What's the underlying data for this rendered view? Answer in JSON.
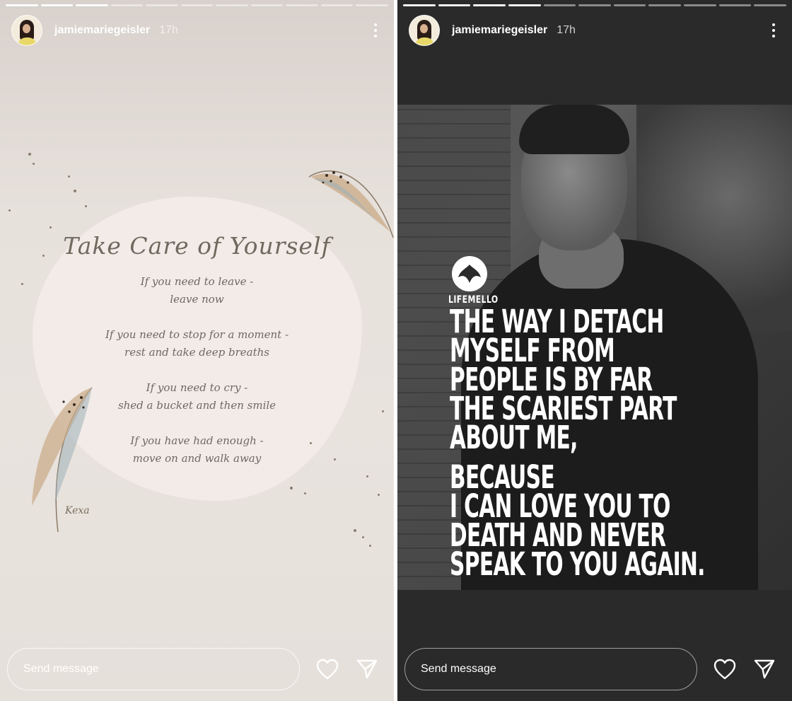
{
  "left_story": {
    "username": "jamiemariegeisler",
    "time": "17h",
    "poem": {
      "title": "Take Care of Yourself",
      "stanzas": [
        [
          "If you need to leave -",
          "leave now"
        ],
        [
          "If you need to stop for a moment -",
          "rest and take deep breaths"
        ],
        [
          "If you need to cry -",
          "shed a bucket and then smile"
        ],
        [
          "If you have had enough -",
          "move on and walk away"
        ]
      ],
      "signature": "Kexa"
    },
    "composer": {
      "placeholder": "Send message"
    }
  },
  "right_story": {
    "username": "jamiemariegeisler",
    "time": "17h",
    "brand": "LIFEMELLO",
    "quote_lines_1": [
      "THE WAY I DETACH",
      "MYSELF FROM",
      "PEOPLE IS BY FAR",
      "THE SCARIEST PART",
      "ABOUT ME,"
    ],
    "quote_lines_2": [
      "BECAUSE",
      "I CAN LOVE YOU TO",
      "DEATH AND NEVER",
      "SPEAK TO YOU AGAIN."
    ],
    "composer": {
      "placeholder": "Send message"
    }
  },
  "icons": {
    "more": "more-vertical-icon",
    "like": "heart-icon",
    "share": "paper-plane-icon"
  }
}
